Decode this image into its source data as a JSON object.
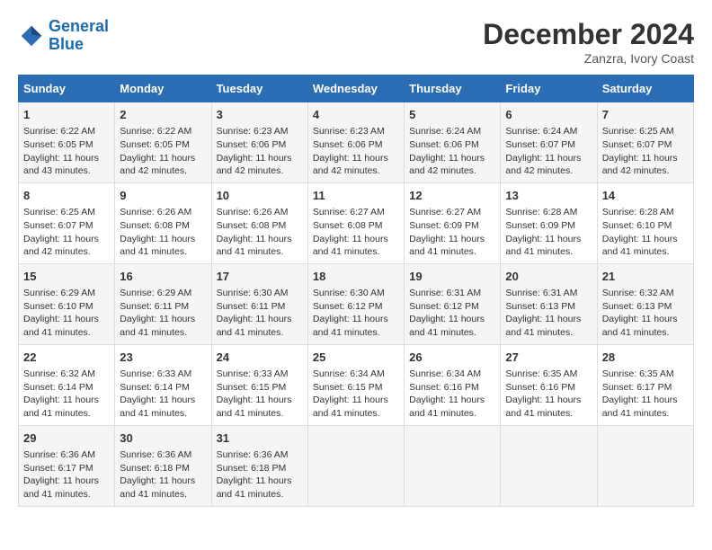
{
  "logo": {
    "line1": "General",
    "line2": "Blue"
  },
  "title": "December 2024",
  "location": "Zanzra, Ivory Coast",
  "days_of_week": [
    "Sunday",
    "Monday",
    "Tuesday",
    "Wednesday",
    "Thursday",
    "Friday",
    "Saturday"
  ],
  "weeks": [
    [
      {
        "day": "1",
        "info": "Sunrise: 6:22 AM\nSunset: 6:05 PM\nDaylight: 11 hours\nand 43 minutes."
      },
      {
        "day": "2",
        "info": "Sunrise: 6:22 AM\nSunset: 6:05 PM\nDaylight: 11 hours\nand 42 minutes."
      },
      {
        "day": "3",
        "info": "Sunrise: 6:23 AM\nSunset: 6:06 PM\nDaylight: 11 hours\nand 42 minutes."
      },
      {
        "day": "4",
        "info": "Sunrise: 6:23 AM\nSunset: 6:06 PM\nDaylight: 11 hours\nand 42 minutes."
      },
      {
        "day": "5",
        "info": "Sunrise: 6:24 AM\nSunset: 6:06 PM\nDaylight: 11 hours\nand 42 minutes."
      },
      {
        "day": "6",
        "info": "Sunrise: 6:24 AM\nSunset: 6:07 PM\nDaylight: 11 hours\nand 42 minutes."
      },
      {
        "day": "7",
        "info": "Sunrise: 6:25 AM\nSunset: 6:07 PM\nDaylight: 11 hours\nand 42 minutes."
      }
    ],
    [
      {
        "day": "8",
        "info": "Sunrise: 6:25 AM\nSunset: 6:07 PM\nDaylight: 11 hours\nand 42 minutes."
      },
      {
        "day": "9",
        "info": "Sunrise: 6:26 AM\nSunset: 6:08 PM\nDaylight: 11 hours\nand 41 minutes."
      },
      {
        "day": "10",
        "info": "Sunrise: 6:26 AM\nSunset: 6:08 PM\nDaylight: 11 hours\nand 41 minutes."
      },
      {
        "day": "11",
        "info": "Sunrise: 6:27 AM\nSunset: 6:08 PM\nDaylight: 11 hours\nand 41 minutes."
      },
      {
        "day": "12",
        "info": "Sunrise: 6:27 AM\nSunset: 6:09 PM\nDaylight: 11 hours\nand 41 minutes."
      },
      {
        "day": "13",
        "info": "Sunrise: 6:28 AM\nSunset: 6:09 PM\nDaylight: 11 hours\nand 41 minutes."
      },
      {
        "day": "14",
        "info": "Sunrise: 6:28 AM\nSunset: 6:10 PM\nDaylight: 11 hours\nand 41 minutes."
      }
    ],
    [
      {
        "day": "15",
        "info": "Sunrise: 6:29 AM\nSunset: 6:10 PM\nDaylight: 11 hours\nand 41 minutes."
      },
      {
        "day": "16",
        "info": "Sunrise: 6:29 AM\nSunset: 6:11 PM\nDaylight: 11 hours\nand 41 minutes."
      },
      {
        "day": "17",
        "info": "Sunrise: 6:30 AM\nSunset: 6:11 PM\nDaylight: 11 hours\nand 41 minutes."
      },
      {
        "day": "18",
        "info": "Sunrise: 6:30 AM\nSunset: 6:12 PM\nDaylight: 11 hours\nand 41 minutes."
      },
      {
        "day": "19",
        "info": "Sunrise: 6:31 AM\nSunset: 6:12 PM\nDaylight: 11 hours\nand 41 minutes."
      },
      {
        "day": "20",
        "info": "Sunrise: 6:31 AM\nSunset: 6:13 PM\nDaylight: 11 hours\nand 41 minutes."
      },
      {
        "day": "21",
        "info": "Sunrise: 6:32 AM\nSunset: 6:13 PM\nDaylight: 11 hours\nand 41 minutes."
      }
    ],
    [
      {
        "day": "22",
        "info": "Sunrise: 6:32 AM\nSunset: 6:14 PM\nDaylight: 11 hours\nand 41 minutes."
      },
      {
        "day": "23",
        "info": "Sunrise: 6:33 AM\nSunset: 6:14 PM\nDaylight: 11 hours\nand 41 minutes."
      },
      {
        "day": "24",
        "info": "Sunrise: 6:33 AM\nSunset: 6:15 PM\nDaylight: 11 hours\nand 41 minutes."
      },
      {
        "day": "25",
        "info": "Sunrise: 6:34 AM\nSunset: 6:15 PM\nDaylight: 11 hours\nand 41 minutes."
      },
      {
        "day": "26",
        "info": "Sunrise: 6:34 AM\nSunset: 6:16 PM\nDaylight: 11 hours\nand 41 minutes."
      },
      {
        "day": "27",
        "info": "Sunrise: 6:35 AM\nSunset: 6:16 PM\nDaylight: 11 hours\nand 41 minutes."
      },
      {
        "day": "28",
        "info": "Sunrise: 6:35 AM\nSunset: 6:17 PM\nDaylight: 11 hours\nand 41 minutes."
      }
    ],
    [
      {
        "day": "29",
        "info": "Sunrise: 6:36 AM\nSunset: 6:17 PM\nDaylight: 11 hours\nand 41 minutes."
      },
      {
        "day": "30",
        "info": "Sunrise: 6:36 AM\nSunset: 6:18 PM\nDaylight: 11 hours\nand 41 minutes."
      },
      {
        "day": "31",
        "info": "Sunrise: 6:36 AM\nSunset: 6:18 PM\nDaylight: 11 hours\nand 41 minutes."
      },
      {
        "day": "",
        "info": ""
      },
      {
        "day": "",
        "info": ""
      },
      {
        "day": "",
        "info": ""
      },
      {
        "day": "",
        "info": ""
      }
    ]
  ]
}
